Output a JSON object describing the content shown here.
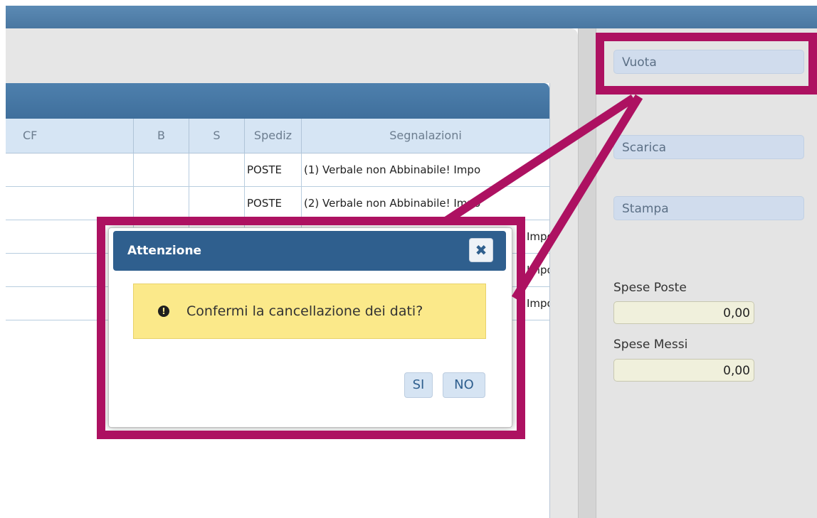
{
  "grid": {
    "columns": [
      "CF",
      "B",
      "S",
      "Spediz",
      "Segnalazioni"
    ],
    "rows": [
      {
        "spediz": "POSTE",
        "segnalazioni": "(1) Verbale non Abbinabile! Impo"
      },
      {
        "spediz": "POSTE",
        "segnalazioni": "(2) Verbale non Abbinabile! Impo"
      },
      {
        "spediz": "",
        "segnalazioni": "Impo"
      },
      {
        "spediz": "",
        "segnalazioni": "Impo"
      },
      {
        "spediz": "",
        "segnalazioni": "Impo"
      }
    ]
  },
  "sidebar": {
    "vuota_label": "Vuota",
    "scarica_label": "Scarica",
    "stampa_label": "Stampa",
    "spese_poste_label": "Spese Poste",
    "spese_poste_value": "0,00",
    "spese_messi_label": "Spese Messi",
    "spese_messi_value": "0,00"
  },
  "dialog": {
    "title": "Attenzione",
    "close_glyph": "✖",
    "message": "Confermi la cancellazione dei dati?",
    "icon": "exclamation-circle-icon",
    "icon_glyph": "!",
    "yes_label": "SI",
    "no_label": "NO"
  },
  "colors": {
    "annotation": "#ad1161",
    "titlebar": "#2f5f8e",
    "message_background": "#fbe98a"
  }
}
